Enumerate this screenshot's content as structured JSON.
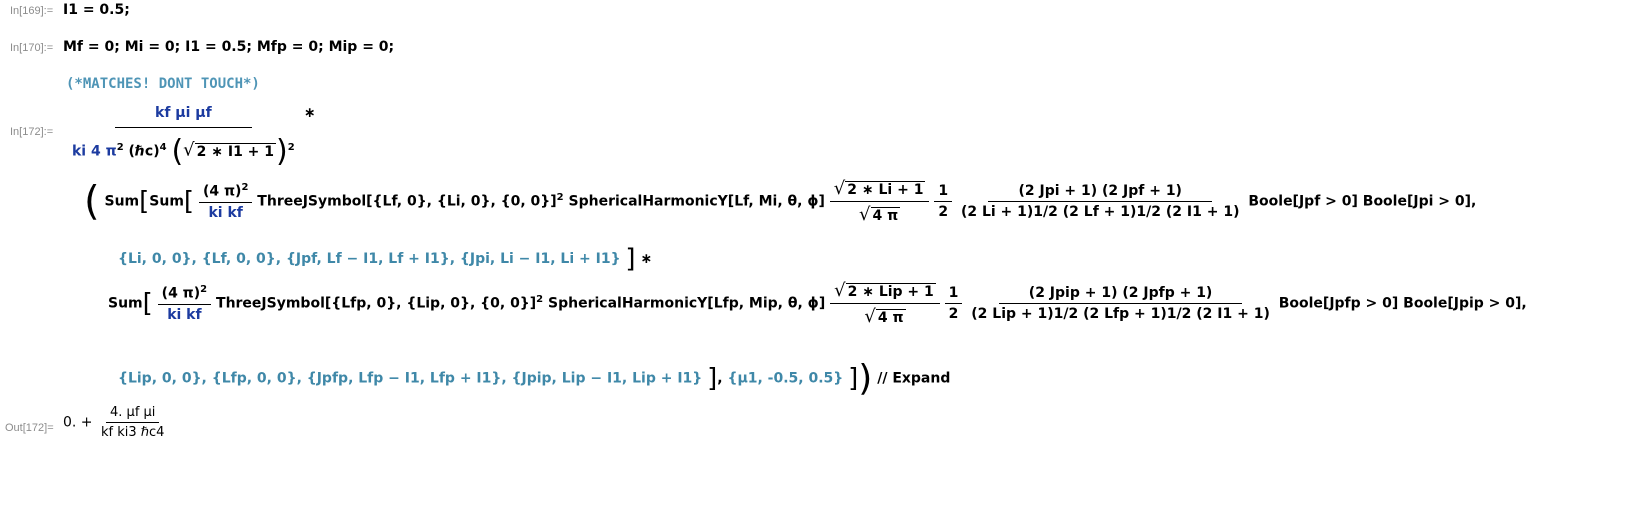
{
  "cells": [
    {
      "label": "In[169]:=",
      "code": "I1 = 0.5;"
    },
    {
      "label": "In[170]:=",
      "code": "Mf = 0; Mi = 0; I1 = 0.5; Mfp = 0; Mip = 0;"
    },
    {
      "comment": "(*MATCHES! DONT TOUCH*)"
    },
    {
      "label": "In[172]:="
    },
    {
      "label": "Out[172]="
    }
  ],
  "prefactor": {
    "numerator": "kf μi μf",
    "denominator_a": "ki 4 π",
    "denominator_b": "(ℏc)",
    "sqrt_body": "2 ∗ I1 + 1"
  },
  "sum1": {
    "coef_num": "(4 π)",
    "coef_den": "ki kf",
    "three_j": "ThreeJSymbol[{Lf, 0}, {Li, 0}, {0, 0}]",
    "harmonic": "SphericalHarmonicY[Lf, Mi, θ, ϕ]",
    "sqrt_num": "2 ∗ Li + 1",
    "sqrt_den": "4 π",
    "half_num": "1",
    "half_den": "2",
    "j_num": "(2 Jpi + 1) (2 Jpf + 1)",
    "j_den": "(2 Li + 1)1/2 (2 Lf + 1)1/2 (2 I1 + 1)",
    "boole": "Boole[Jpf > 0] Boole[Jpi > 0],",
    "ranges": "{Li, 0, 0}, {Lf, 0, 0}, {Jpf, Lf − I1, Lf + I1}, {Jpi, Li − I1, Li + I1}"
  },
  "sum2": {
    "coef_num": "(4 π)",
    "coef_den": "ki kf",
    "three_j": "ThreeJSymbol[{Lfp, 0}, {Lip, 0}, {0, 0}]",
    "harmonic": "SphericalHarmonicY[Lfp, Mip, θ, ϕ]",
    "sqrt_num": "2 ∗ Lip + 1",
    "sqrt_den": "4 π",
    "half_num": "1",
    "half_den": "2",
    "j_num": "(2 Jpip + 1) (2 Jpfp + 1)",
    "j_den": "(2 Lip + 1)1/2 (2 Lfp + 1)1/2 (2 I1 + 1)",
    "boole": "Boole[Jpfp > 0] Boole[Jpip > 0],",
    "ranges": "{Lip, 0, 0}, {Lfp, 0, 0}, {Jpfp, Lfp − I1, Lfp + I1}, {Jpip, Lip − I1, Lip + I1}",
    "mu_range": "{μ1, -0.5, 0.5}",
    "postfix": "// Expand"
  },
  "output": {
    "lead": "0. +",
    "num": "4. μf μi",
    "den": "kf ki3 ℏc4"
  }
}
